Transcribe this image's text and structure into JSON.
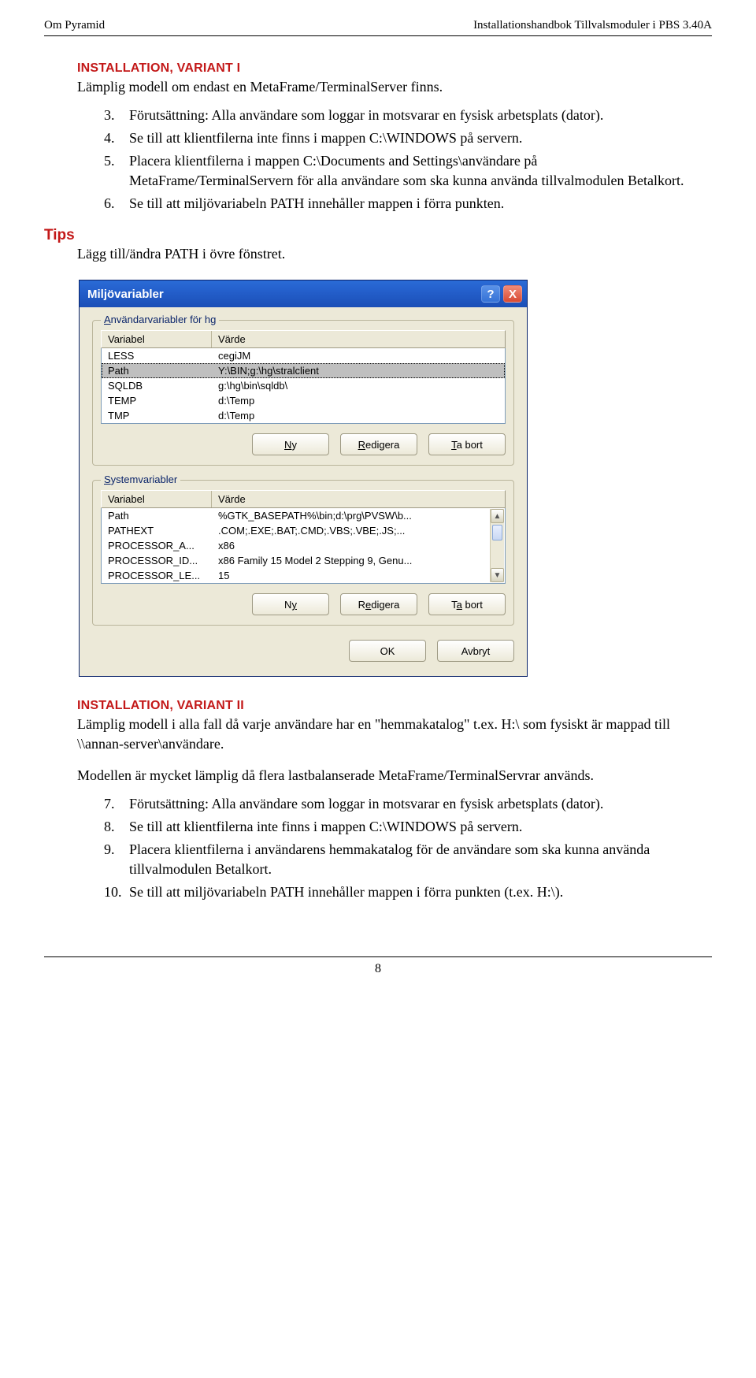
{
  "header": {
    "left": "Om Pyramid",
    "right": "Installationshandbok Tillvalsmoduler i PBS 3.40A"
  },
  "variant1": {
    "heading": "INSTALLATION, VARIANT I",
    "intro": "Lämplig modell om endast en MetaFrame/TerminalServer finns.",
    "items": [
      {
        "n": "3.",
        "t": "Förutsättning: Alla användare som loggar in motsvarar en fysisk arbetsplats (dator)."
      },
      {
        "n": "4.",
        "t": "Se till att klientfilerna inte finns i mappen C:\\WINDOWS på servern."
      },
      {
        "n": "5.",
        "t": "Placera klientfilerna i mappen C:\\Documents and Settings\\användare på MetaFrame/TerminalServern för alla användare som ska kunna använda tillvalmodulen Betalkort."
      },
      {
        "n": "6.",
        "t": "Se till att miljövariabeln PATH innehåller mappen i förra punkten."
      }
    ]
  },
  "tips": {
    "label": "Tips",
    "body": "Lägg till/ändra PATH i övre fönstret."
  },
  "dialog": {
    "title": "Miljövariabler",
    "help": "?",
    "close": "X",
    "userGroup": {
      "legendPrefix": "Användarvariabler för hg",
      "col1": "Variabel",
      "col2": "Värde",
      "rows": [
        {
          "v": "LESS",
          "val": "cegiJM",
          "sel": false
        },
        {
          "v": "Path",
          "val": "Y:\\BIN;g:\\hg\\stralclient",
          "sel": true
        },
        {
          "v": "SQLDB",
          "val": "g:\\hg\\bin\\sqldb\\",
          "sel": false
        },
        {
          "v": "TEMP",
          "val": "d:\\Temp",
          "sel": false
        },
        {
          "v": "TMP",
          "val": "d:\\Temp",
          "sel": false
        }
      ],
      "btnNew": "Ny",
      "btnNewU": "N",
      "btnEdit": "Redigera",
      "btnEditU": "R",
      "btnDel": "Ta bort",
      "btnDelU": "T"
    },
    "sysGroup": {
      "legend": "Systemvariabler",
      "legendU": "S",
      "col1": "Variabel",
      "col2": "Värde",
      "rows": [
        {
          "v": "Path",
          "val": "%GTK_BASEPATH%\\bin;d:\\prg\\PVSW\\b..."
        },
        {
          "v": "PATHEXT",
          "val": ".COM;.EXE;.BAT;.CMD;.VBS;.VBE;.JS;..."
        },
        {
          "v": "PROCESSOR_A...",
          "val": "x86"
        },
        {
          "v": "PROCESSOR_ID...",
          "val": "x86 Family 15 Model 2 Stepping 9, Genu..."
        },
        {
          "v": "PROCESSOR_LE...",
          "val": "15"
        }
      ],
      "btnNew": "Ny",
      "btnNewU": "y",
      "btnEdit": "Redigera",
      "btnEditU": "e",
      "btnDel": "Ta bort",
      "btnDelU": "a"
    },
    "ok": "OK",
    "cancel": "Avbryt"
  },
  "variant2": {
    "heading": "INSTALLATION, VARIANT II",
    "intro": "Lämplig modell i alla fall då varje användare har en \"hemmakatalog\" t.ex. H:\\ som fysiskt är mappad till \\\\annan-server\\användare.",
    "para2": "Modellen är mycket lämplig då flera lastbalanserade MetaFrame/TerminalServrar används.",
    "items": [
      {
        "n": "7.",
        "t": "Förutsättning: Alla användare som loggar in motsvarar en fysisk arbetsplats (dator)."
      },
      {
        "n": "8.",
        "t": "Se till att klientfilerna inte finns i mappen C:\\WINDOWS på servern."
      },
      {
        "n": "9.",
        "t": "Placera klientfilerna i användarens hemmakatalog för de användare som ska kunna använda tillvalmodulen Betalkort."
      },
      {
        "n": "10.",
        "t": "Se till att miljövariabeln PATH innehåller mappen i förra punkten (t.ex. H:\\)."
      }
    ]
  },
  "page_number": "8"
}
